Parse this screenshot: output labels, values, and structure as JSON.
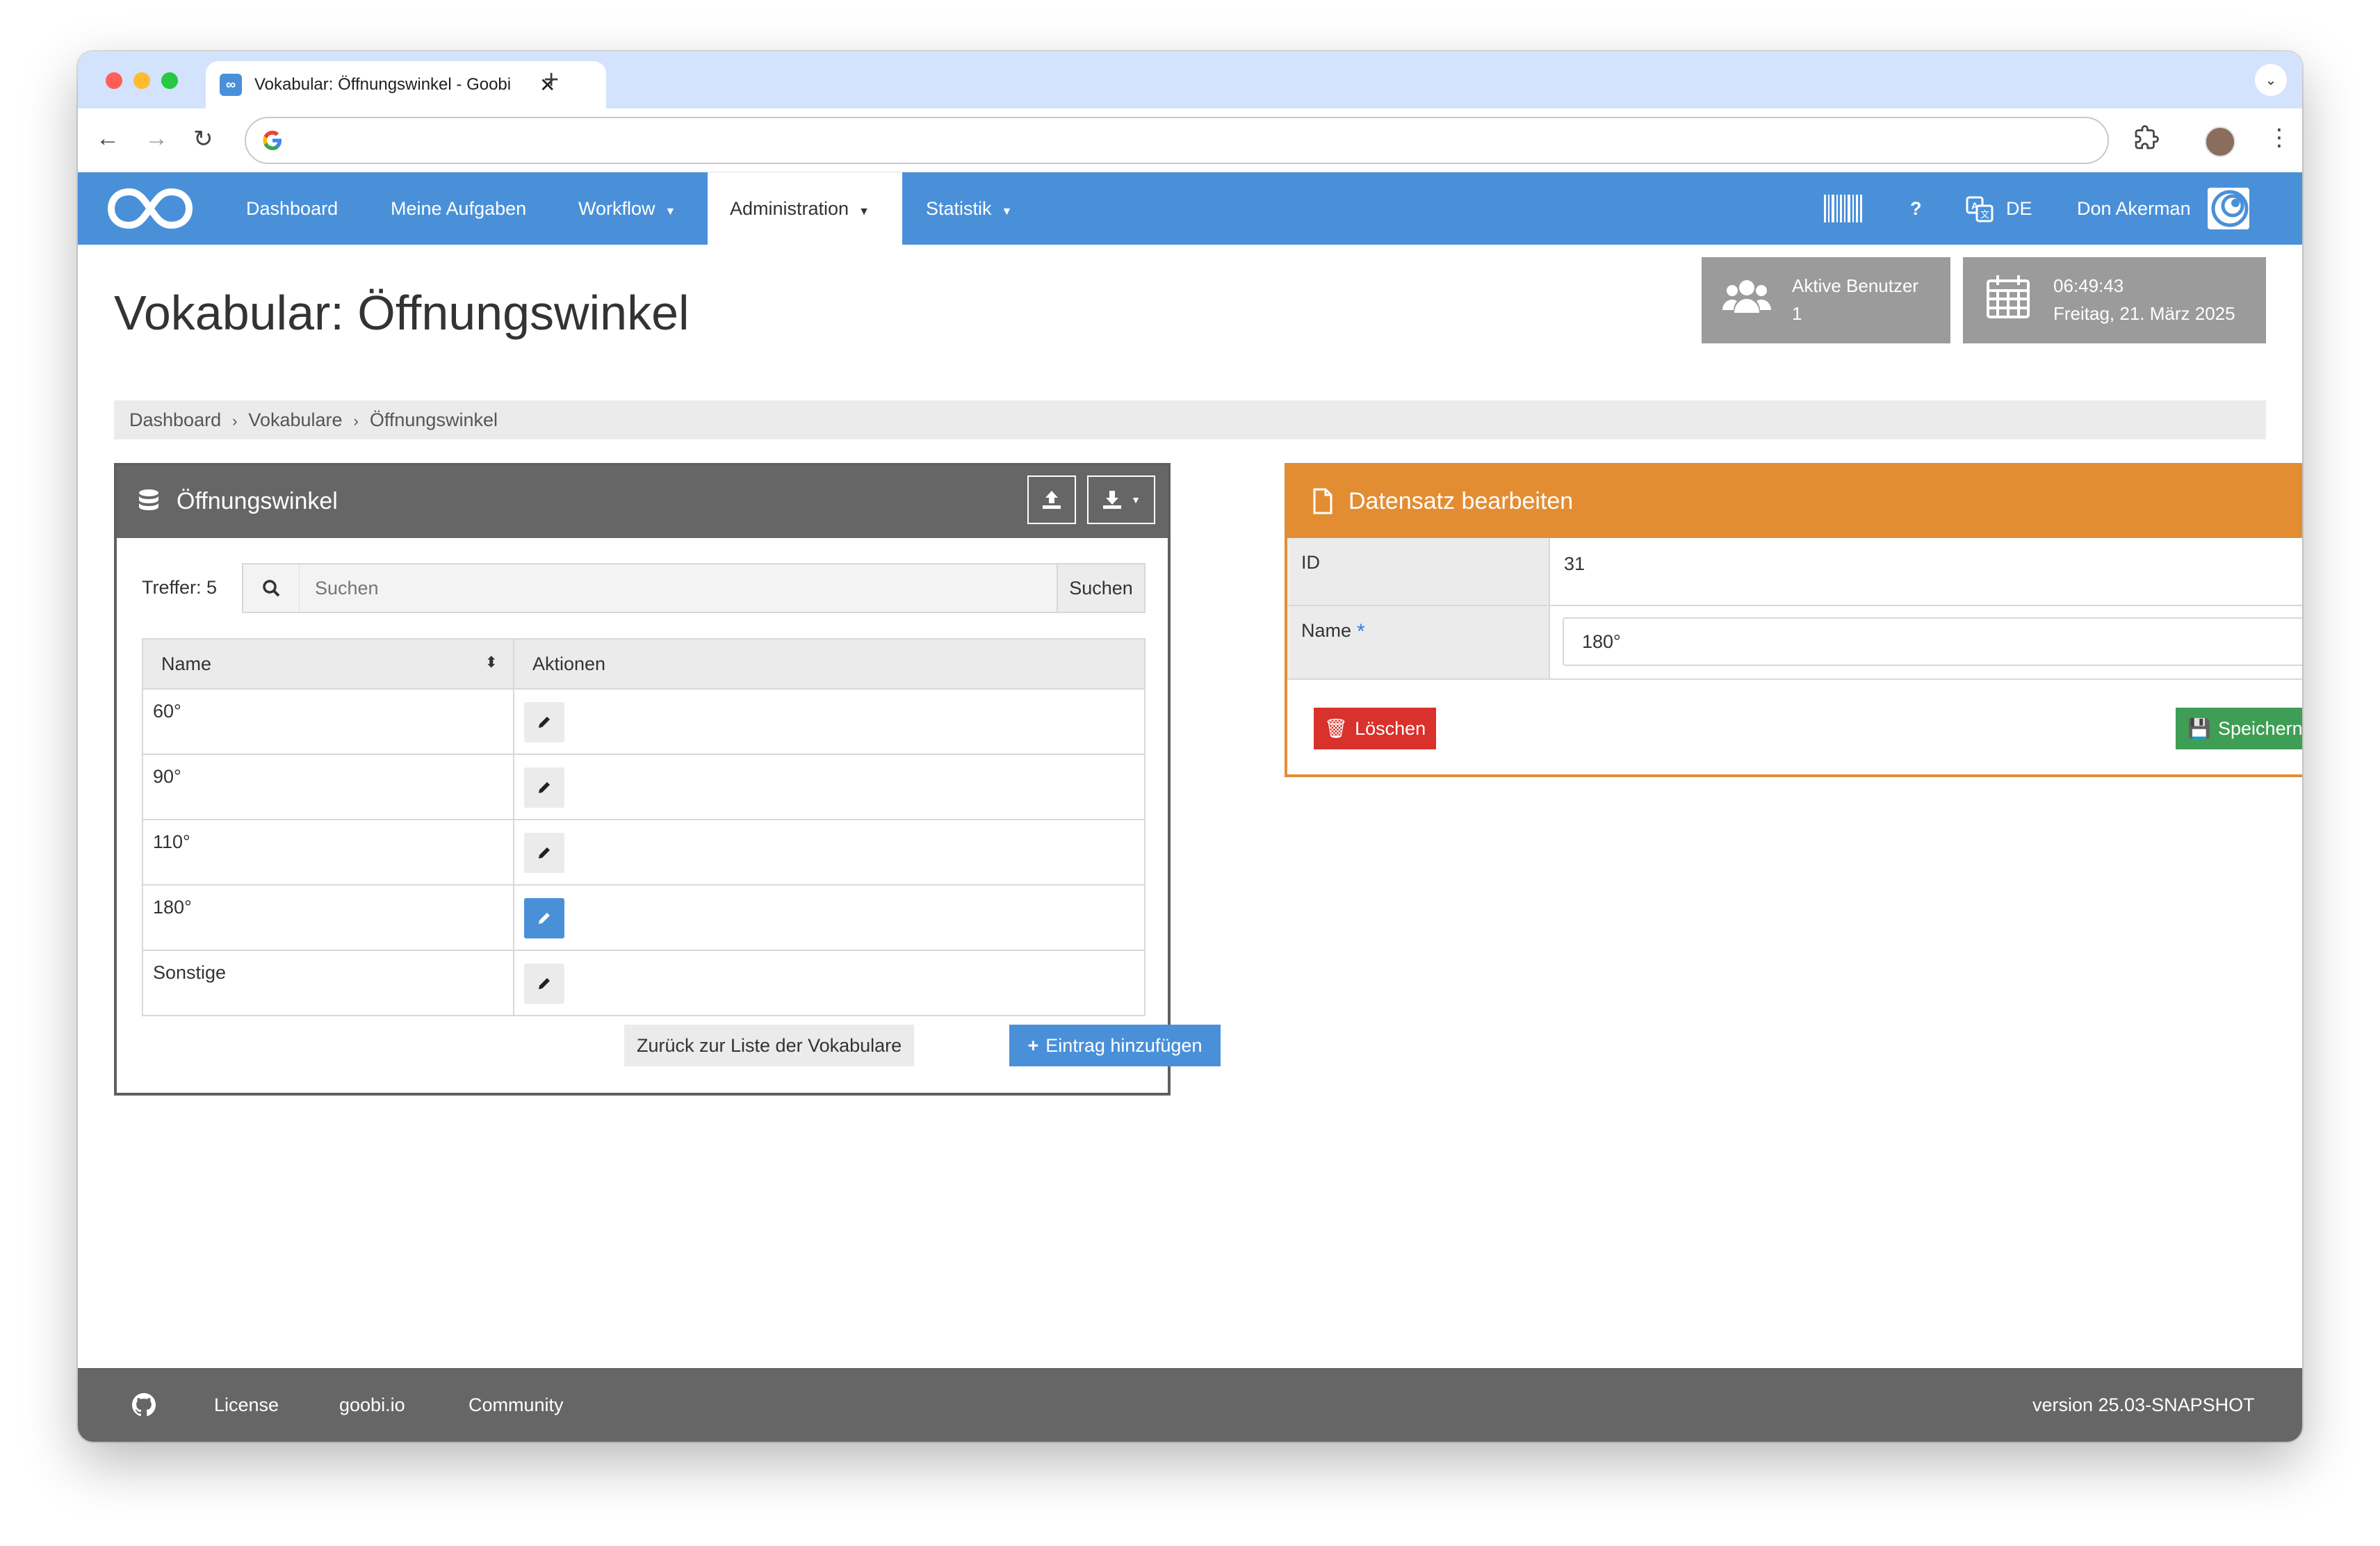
{
  "browser": {
    "tab_title": "Vokabular: Öffnungswinkel - Goobi",
    "tab_close": "✕",
    "new_tab": "+",
    "tabs_menu": "⌄",
    "back": "←",
    "forward": "→",
    "reload": "↻",
    "more": "⋮"
  },
  "navbar": {
    "items": [
      {
        "label": "Dashboard"
      },
      {
        "label": "Meine Aufgaben"
      },
      {
        "label": "Workflow"
      },
      {
        "label": "Administration"
      },
      {
        "label": "Statistik"
      }
    ],
    "active_index": 3,
    "help": "?",
    "language": "DE",
    "user_name": "Don Akerman"
  },
  "page": {
    "title": "Vokabular: Öffnungswinkel"
  },
  "info_boxes": {
    "users": {
      "label": "Aktive Benutzer",
      "value": "1"
    },
    "clock": {
      "time": "06:49:43",
      "date": "Freitag, 21. März 2025"
    }
  },
  "breadcrumb": [
    "Dashboard",
    "Vokabulare",
    "Öffnungswinkel"
  ],
  "vocab_panel": {
    "title": "Öffnungswinkel",
    "hits_label": "Treffer: 5",
    "search_placeholder": "Suchen",
    "search_button": "Suchen",
    "columns": [
      "Name",
      "Aktionen"
    ],
    "rows": [
      {
        "name": "60°"
      },
      {
        "name": "90°"
      },
      {
        "name": "110°"
      },
      {
        "name": "180°",
        "selected": true
      },
      {
        "name": "Sonstige"
      }
    ],
    "back_button": "Zurück zur Liste der Vokabulare",
    "add_button": "Eintrag hinzufügen"
  },
  "edit_panel": {
    "title": "Datensatz bearbeiten",
    "id_label": "ID",
    "id_value": "31",
    "name_label": "Name",
    "required_mark": "*",
    "name_value": "180°",
    "delete_button": "Löschen",
    "save_button": "Speichern"
  },
  "footer": {
    "links": [
      "License",
      "goobi.io",
      "Community"
    ],
    "version": "version 25.03-SNAPSHOT"
  },
  "colors": {
    "navbar": "#4a90d9",
    "panel_dark": "#666666",
    "panel_orange": "#e38d33",
    "delete": "#d9312b",
    "save": "#3f9e56",
    "primary": "#4a90d9"
  }
}
